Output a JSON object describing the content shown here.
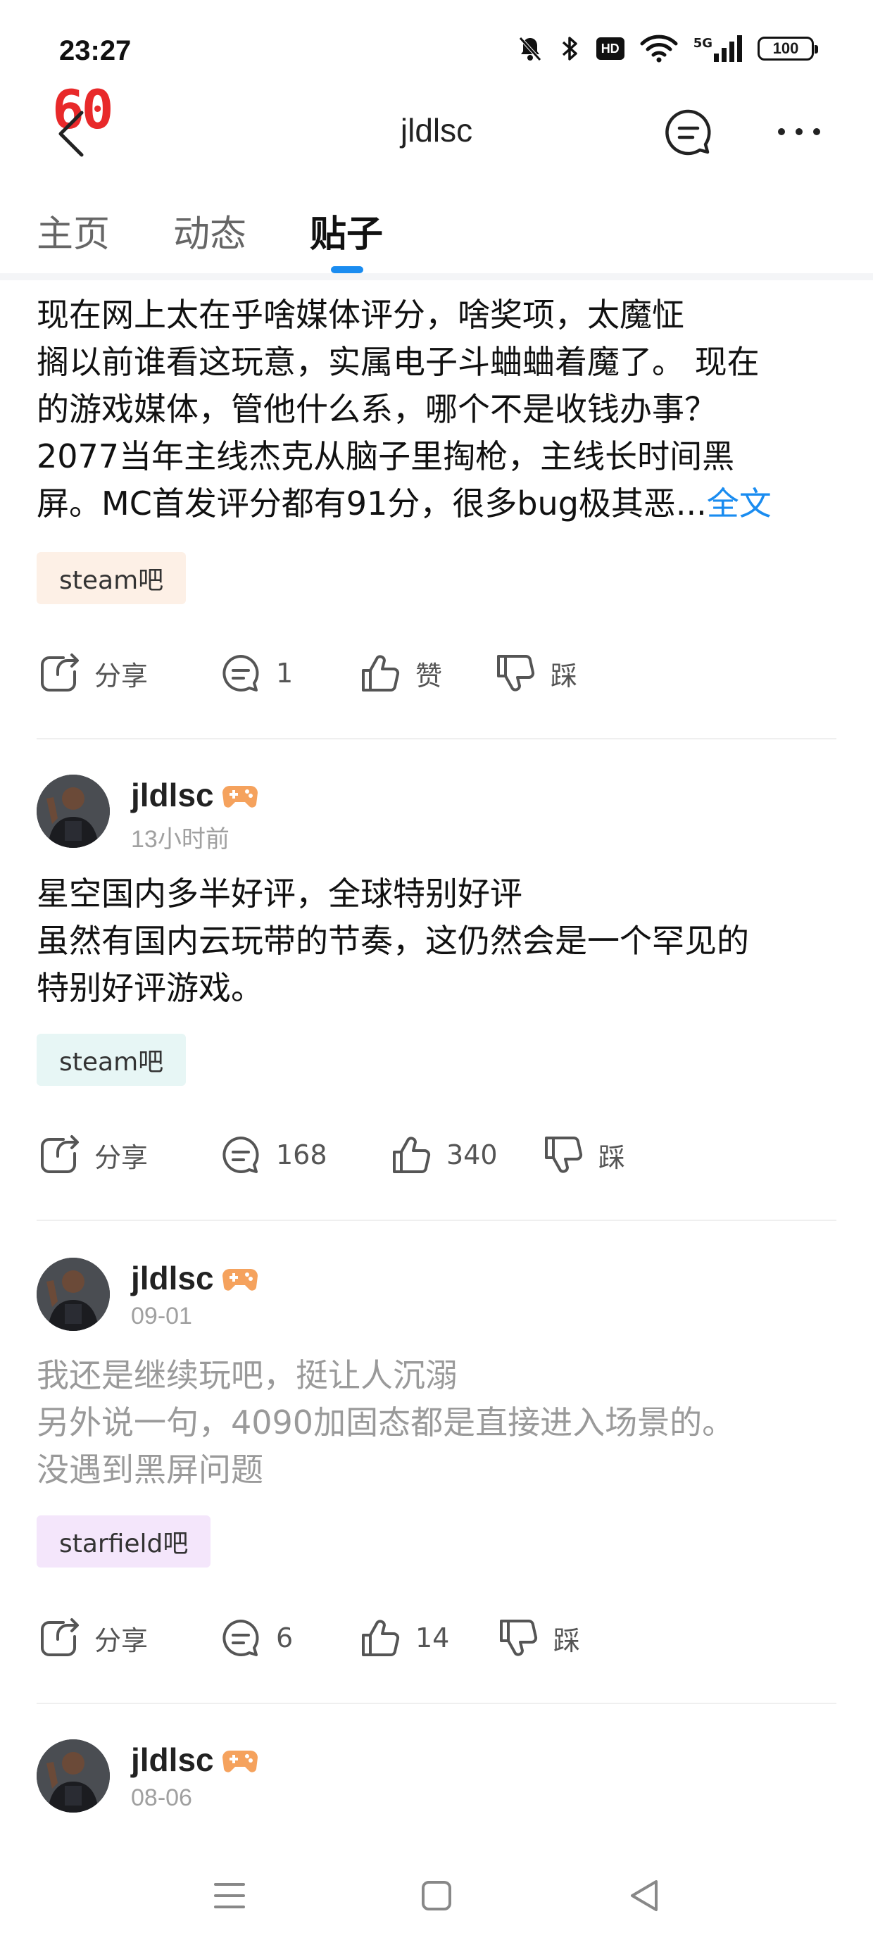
{
  "status": {
    "time": "23:27",
    "hd_label": "HD",
    "signal_label": "5G",
    "battery": "100"
  },
  "header": {
    "fps_overlay": "60",
    "title": "jldlsc"
  },
  "tabs": [
    {
      "label": "主页",
      "active": false
    },
    {
      "label": "动态",
      "active": false
    },
    {
      "label": "贴子",
      "active": true
    }
  ],
  "posts": [
    {
      "lines": [
        "现在网上太在乎啥媒体评分，啥奖项，太魔怔",
        "搁以前谁看这玩意，实属电子斗蛐蛐着魔了。 现在",
        "的游戏媒体，管他什么系，哪个不是收钱办事？",
        "2077当年主线杰克从脑子里掏枪，主线长时间黑",
        "屏。MC首发评分都有91分，很多bug极其恶..."
      ],
      "more_label": "全文",
      "tag": "steam吧",
      "tag_color": "#fdf0e6",
      "share_label": "分享",
      "comments": "1",
      "likes": "赞",
      "dislike_label": "踩"
    },
    {
      "author": "jldlsc",
      "time": "13小时前",
      "lines": [
        "星空国内多半好评，全球特别好评",
        "虽然有国内云玩带的节奏，这仍然会是一个罕见的",
        "特别好评游戏。"
      ],
      "tag": "steam吧",
      "tag_color": "#e7f6f5",
      "share_label": "分享",
      "comments": "168",
      "likes": "340",
      "dislike_label": "踩"
    },
    {
      "author": "jldlsc",
      "time": "09-01",
      "lines": [
        "我还是继续玩吧，挺让人沉溺",
        "另外说一句，4090加固态都是直接进入场景的。",
        "没遇到黑屏问题"
      ],
      "tag": "starfield吧",
      "tag_color": "#f4e6fb",
      "share_label": "分享",
      "comments": "6",
      "likes": "14",
      "dislike_label": "踩"
    },
    {
      "author": "jldlsc",
      "time": "08-06"
    }
  ],
  "colors": {
    "accent": "#1a8cf0",
    "fps_red": "#e8292a",
    "muted_text": "#9a9a9a"
  },
  "icons": {
    "back": "chevron-left-icon",
    "message": "chat-bubble-icon",
    "more": "ellipsis-icon",
    "share": "share-icon",
    "comment": "comment-icon",
    "like": "thumbs-up-icon",
    "dislike": "thumbs-down-icon",
    "game_badge": "gamepad-icon"
  }
}
